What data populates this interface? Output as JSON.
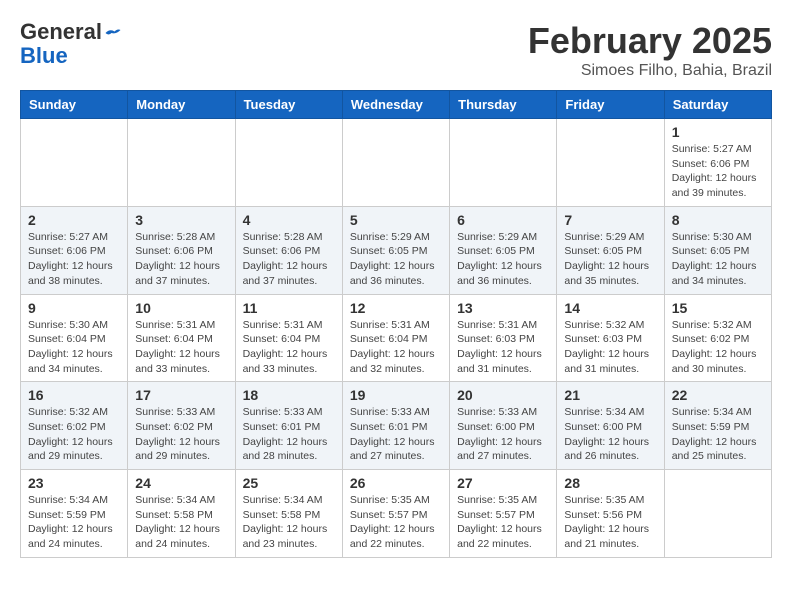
{
  "header": {
    "logo_line1": "General",
    "logo_line2": "Blue",
    "month": "February 2025",
    "location": "Simoes Filho, Bahia, Brazil"
  },
  "weekdays": [
    "Sunday",
    "Monday",
    "Tuesday",
    "Wednesday",
    "Thursday",
    "Friday",
    "Saturday"
  ],
  "weeks": [
    [
      {
        "day": "",
        "info": ""
      },
      {
        "day": "",
        "info": ""
      },
      {
        "day": "",
        "info": ""
      },
      {
        "day": "",
        "info": ""
      },
      {
        "day": "",
        "info": ""
      },
      {
        "day": "",
        "info": ""
      },
      {
        "day": "1",
        "info": "Sunrise: 5:27 AM\nSunset: 6:06 PM\nDaylight: 12 hours and 39 minutes."
      }
    ],
    [
      {
        "day": "2",
        "info": "Sunrise: 5:27 AM\nSunset: 6:06 PM\nDaylight: 12 hours and 38 minutes."
      },
      {
        "day": "3",
        "info": "Sunrise: 5:28 AM\nSunset: 6:06 PM\nDaylight: 12 hours and 37 minutes."
      },
      {
        "day": "4",
        "info": "Sunrise: 5:28 AM\nSunset: 6:06 PM\nDaylight: 12 hours and 37 minutes."
      },
      {
        "day": "5",
        "info": "Sunrise: 5:29 AM\nSunset: 6:05 PM\nDaylight: 12 hours and 36 minutes."
      },
      {
        "day": "6",
        "info": "Sunrise: 5:29 AM\nSunset: 6:05 PM\nDaylight: 12 hours and 36 minutes."
      },
      {
        "day": "7",
        "info": "Sunrise: 5:29 AM\nSunset: 6:05 PM\nDaylight: 12 hours and 35 minutes."
      },
      {
        "day": "8",
        "info": "Sunrise: 5:30 AM\nSunset: 6:05 PM\nDaylight: 12 hours and 34 minutes."
      }
    ],
    [
      {
        "day": "9",
        "info": "Sunrise: 5:30 AM\nSunset: 6:04 PM\nDaylight: 12 hours and 34 minutes."
      },
      {
        "day": "10",
        "info": "Sunrise: 5:31 AM\nSunset: 6:04 PM\nDaylight: 12 hours and 33 minutes."
      },
      {
        "day": "11",
        "info": "Sunrise: 5:31 AM\nSunset: 6:04 PM\nDaylight: 12 hours and 33 minutes."
      },
      {
        "day": "12",
        "info": "Sunrise: 5:31 AM\nSunset: 6:04 PM\nDaylight: 12 hours and 32 minutes."
      },
      {
        "day": "13",
        "info": "Sunrise: 5:31 AM\nSunset: 6:03 PM\nDaylight: 12 hours and 31 minutes."
      },
      {
        "day": "14",
        "info": "Sunrise: 5:32 AM\nSunset: 6:03 PM\nDaylight: 12 hours and 31 minutes."
      },
      {
        "day": "15",
        "info": "Sunrise: 5:32 AM\nSunset: 6:02 PM\nDaylight: 12 hours and 30 minutes."
      }
    ],
    [
      {
        "day": "16",
        "info": "Sunrise: 5:32 AM\nSunset: 6:02 PM\nDaylight: 12 hours and 29 minutes."
      },
      {
        "day": "17",
        "info": "Sunrise: 5:33 AM\nSunset: 6:02 PM\nDaylight: 12 hours and 29 minutes."
      },
      {
        "day": "18",
        "info": "Sunrise: 5:33 AM\nSunset: 6:01 PM\nDaylight: 12 hours and 28 minutes."
      },
      {
        "day": "19",
        "info": "Sunrise: 5:33 AM\nSunset: 6:01 PM\nDaylight: 12 hours and 27 minutes."
      },
      {
        "day": "20",
        "info": "Sunrise: 5:33 AM\nSunset: 6:00 PM\nDaylight: 12 hours and 27 minutes."
      },
      {
        "day": "21",
        "info": "Sunrise: 5:34 AM\nSunset: 6:00 PM\nDaylight: 12 hours and 26 minutes."
      },
      {
        "day": "22",
        "info": "Sunrise: 5:34 AM\nSunset: 5:59 PM\nDaylight: 12 hours and 25 minutes."
      }
    ],
    [
      {
        "day": "23",
        "info": "Sunrise: 5:34 AM\nSunset: 5:59 PM\nDaylight: 12 hours and 24 minutes."
      },
      {
        "day": "24",
        "info": "Sunrise: 5:34 AM\nSunset: 5:58 PM\nDaylight: 12 hours and 24 minutes."
      },
      {
        "day": "25",
        "info": "Sunrise: 5:34 AM\nSunset: 5:58 PM\nDaylight: 12 hours and 23 minutes."
      },
      {
        "day": "26",
        "info": "Sunrise: 5:35 AM\nSunset: 5:57 PM\nDaylight: 12 hours and 22 minutes."
      },
      {
        "day": "27",
        "info": "Sunrise: 5:35 AM\nSunset: 5:57 PM\nDaylight: 12 hours and 22 minutes."
      },
      {
        "day": "28",
        "info": "Sunrise: 5:35 AM\nSunset: 5:56 PM\nDaylight: 12 hours and 21 minutes."
      },
      {
        "day": "",
        "info": ""
      }
    ]
  ]
}
